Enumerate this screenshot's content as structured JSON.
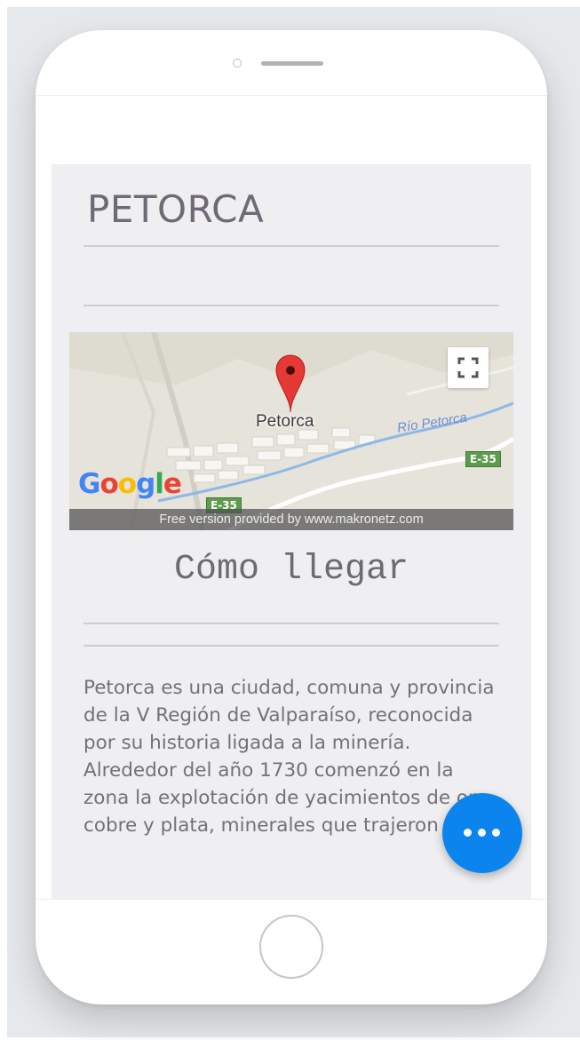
{
  "page": {
    "title": "PETORCA"
  },
  "map": {
    "place_label": "Petorca",
    "river_label": "Río Petorca",
    "road_label": "E-35",
    "road_label_2": "E-35",
    "logo": {
      "letters": [
        "G",
        "o",
        "o",
        "g",
        "l",
        "e"
      ],
      "colors": [
        "#4285f4",
        "#ea4335",
        "#fbbc05",
        "#4285f4",
        "#34a853",
        "#ea4335"
      ]
    },
    "credit": "Free version provided by www.makronetz.com",
    "pin_color": "#e53935",
    "fullscreen_icon": "fullscreen-icon"
  },
  "directions": {
    "label": "Cómo llegar"
  },
  "description": "Petorca es una ciudad, comuna y provincia de la V Región de Valparaíso, reconocida por su historia ligada a la minería. Alrededor del año 1730 comenzó en la zona la explotación de yacimientos de oro, cobre y plata, minerales que trajeron",
  "fab": {
    "icon": "more-horizontal-icon",
    "color": "#0b84ee"
  }
}
